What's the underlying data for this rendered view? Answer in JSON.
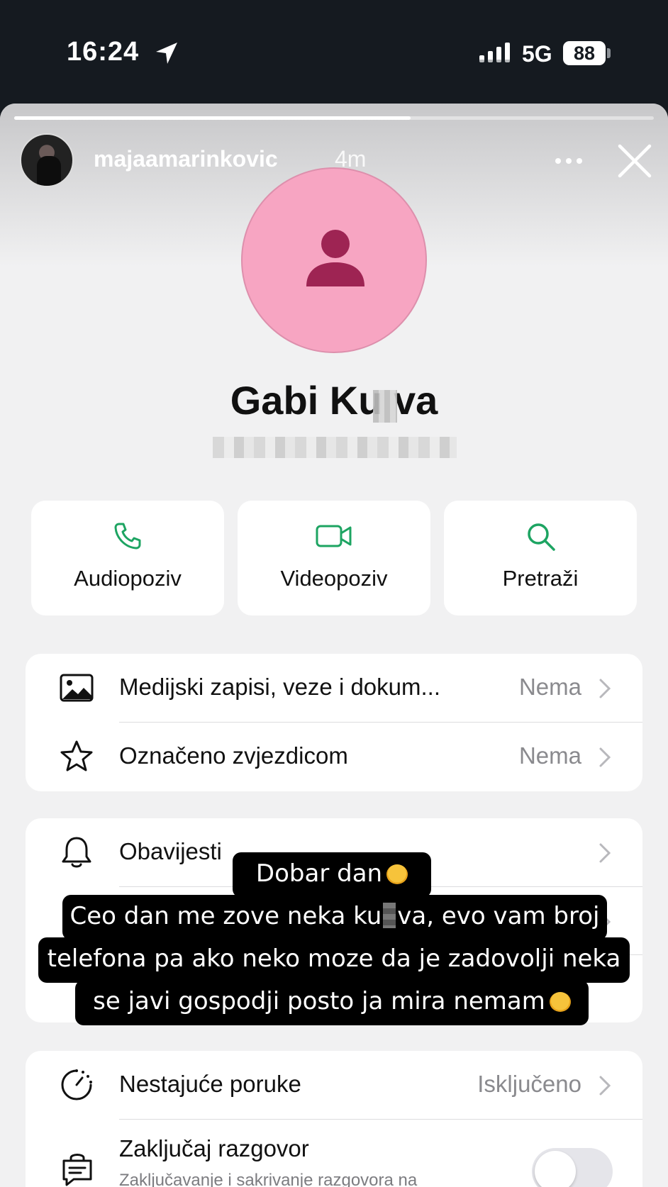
{
  "status_bar": {
    "time": "16:24",
    "network": "5G",
    "battery": "88"
  },
  "story": {
    "username": "majaamarinkovic",
    "time_ago": "4m",
    "progress": 0.62
  },
  "contact": {
    "name": "Gabi Ku  va"
  },
  "actions": [
    {
      "label": "Audiopoziv",
      "icon": "phone-icon"
    },
    {
      "label": "Videopoziv",
      "icon": "video-icon"
    },
    {
      "label": "Pretraži",
      "icon": "search-icon"
    }
  ],
  "media_card": {
    "media": {
      "label": "Medijski zapisi, veze i dokum...",
      "value": "Nema"
    },
    "starred": {
      "label": "Označeno zvjezdicom",
      "value": "Nema"
    }
  },
  "notifications_card": {
    "notifications": {
      "label": "Obavijesti"
    }
  },
  "privacy_card": {
    "disappearing": {
      "label": "Nestajuće poruke",
      "value": "Isključeno"
    },
    "lock": {
      "label": "Zaključaj razgovor",
      "sublabel": "Zaključavanje i sakrivanje razgovora na",
      "enabled": false
    }
  },
  "caption": {
    "line1": "Dobar dan",
    "line2_a": "Ceo dan me zove neka ku",
    "line2_b": "va, evo vam broj",
    "line3": "telefona pa ako neko moze da je zadovolji neka",
    "line4": "se javi gospodji posto ja mira nemam"
  },
  "colors": {
    "accent_green": "#1da462",
    "avatar_pink": "#f7a5c2",
    "avatar_icon": "#9e2453"
  }
}
